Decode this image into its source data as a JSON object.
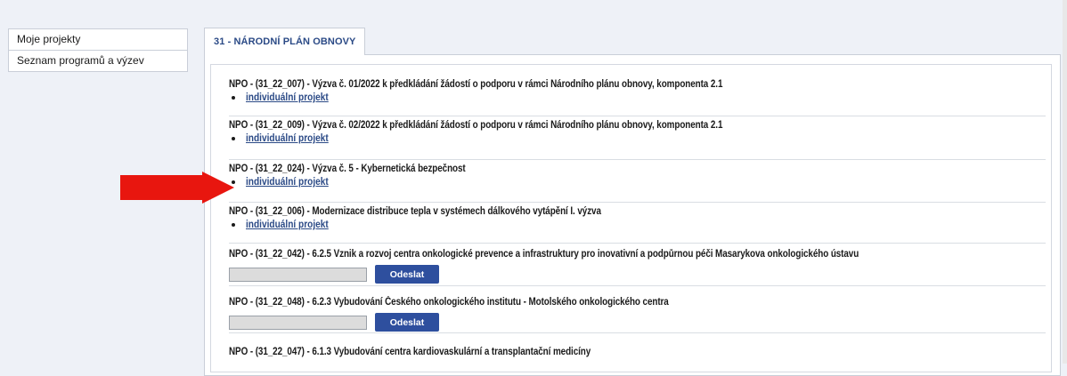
{
  "sidebar": {
    "items": [
      {
        "label": "Moje projekty"
      },
      {
        "label": "Seznam programů a výzev"
      }
    ]
  },
  "tabs": [
    {
      "label": "31 - NÁRODNÍ PLÁN OBNOVY",
      "active": true
    }
  ],
  "calls": [
    {
      "title": "NPO - (31_22_007) - Výzva č. 01/2022 k předkládání žádostí o podporu v rámci Národního plánu obnovy, komponenta 2.1",
      "link": "individuální projekt"
    },
    {
      "title": "NPO - (31_22_009) - Výzva č. 02/2022 k předkládání žádostí o podporu v rámci Národního plánu obnovy, komponenta 2.1",
      "link": "individuální projekt"
    },
    {
      "title": "NPO - (31_22_024) - Výzva č. 5 - Kybernetická bezpečnost",
      "link": "individuální projekt"
    },
    {
      "title": "NPO - (31_22_006) - Modernizace distribuce tepla v systémech dálkového vytápění I. výzva",
      "link": "individuální projekt"
    },
    {
      "title": "NPO - (31_22_042) - 6.2.5 Vznik a rozvoj centra onkologické prevence a infrastruktury pro inovativní a podpůrnou péči Masarykova onkologického ústavu",
      "input_value": "",
      "button": "Odeslat"
    },
    {
      "title": "NPO - (31_22_048) - 6.2.3 Vybudování Českého onkologického institutu - Motolského onkologického centra",
      "input_value": "",
      "button": "Odeslat"
    },
    {
      "title": "NPO - (31_22_047) - 6.1.3 Vybudování centra kardiovaskulární a transplantační medicíny"
    }
  ],
  "colors": {
    "accent": "#2b4a86",
    "button": "#2e4f9e",
    "arrow": "#e8160f",
    "background": "#eef1f7"
  },
  "icons": {
    "highlight_arrow": "red-arrow-icon"
  }
}
